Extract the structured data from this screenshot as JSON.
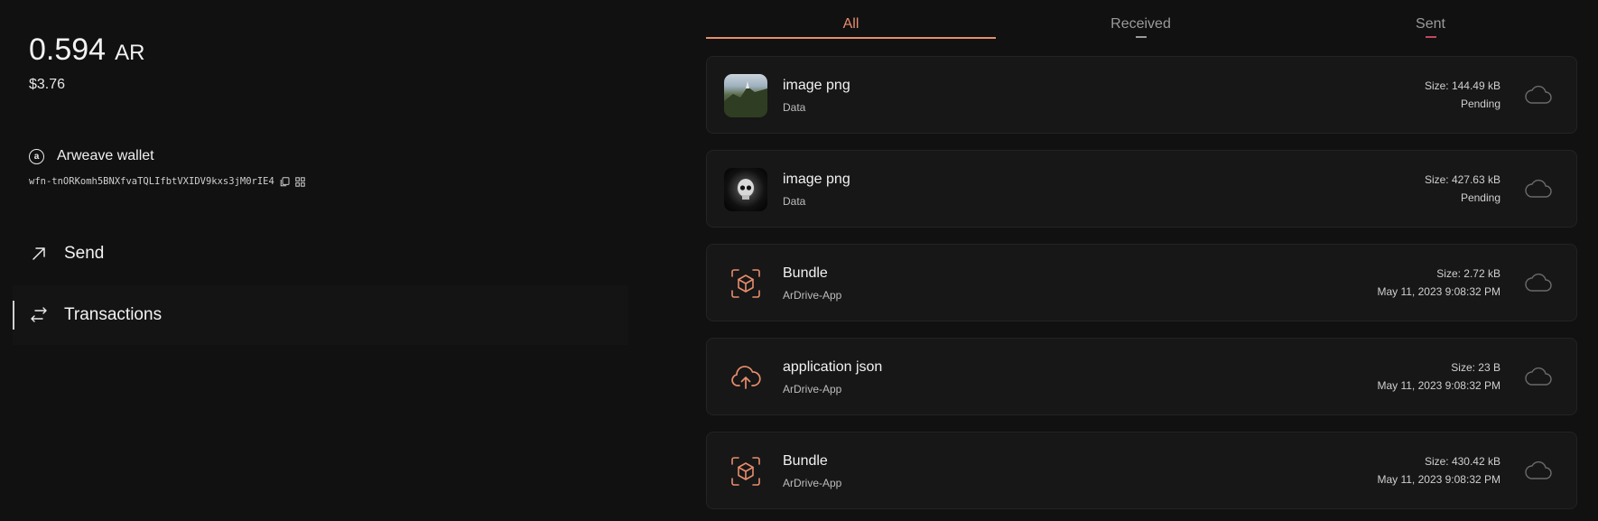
{
  "wallet": {
    "balance": "0.594",
    "unit": "AR",
    "fiat": "$3.76",
    "name": "Arweave wallet",
    "icon_glyph": "a",
    "address": "wfn-tnORKomh5BNXfvaTQLIfbtVXIDV9kxs3jM0rIE4"
  },
  "nav": {
    "send_label": "Send",
    "transactions_label": "Transactions"
  },
  "tabs": {
    "all": "All",
    "received": "Received",
    "sent": "Sent"
  },
  "transactions": [
    {
      "title": "image png",
      "subtitle": "Data",
      "size": "Size: 144.49 kB",
      "status": "Pending",
      "icon": "landscape-thumbnail"
    },
    {
      "title": "image png",
      "subtitle": "Data",
      "size": "Size: 427.63 kB",
      "status": "Pending",
      "icon": "skull-thumbnail"
    },
    {
      "title": "Bundle",
      "subtitle": "ArDrive-App",
      "size": "Size: 2.72 kB",
      "status": "May 11, 2023 9:08:32 PM",
      "icon": "bundle-cube-icon"
    },
    {
      "title": "application json",
      "subtitle": "ArDrive-App",
      "size": "Size: 23 B",
      "status": "May 11, 2023 9:08:32 PM",
      "icon": "cloud-upload-icon"
    },
    {
      "title": "Bundle",
      "subtitle": "ArDrive-App",
      "size": "Size: 430.42 kB",
      "status": "May 11, 2023 9:08:32 PM",
      "icon": "bundle-cube-icon"
    }
  ],
  "colors": {
    "background": "#111111",
    "accent": "#e88d6c",
    "card": "#171717",
    "sent_marker": "#c0485e"
  }
}
